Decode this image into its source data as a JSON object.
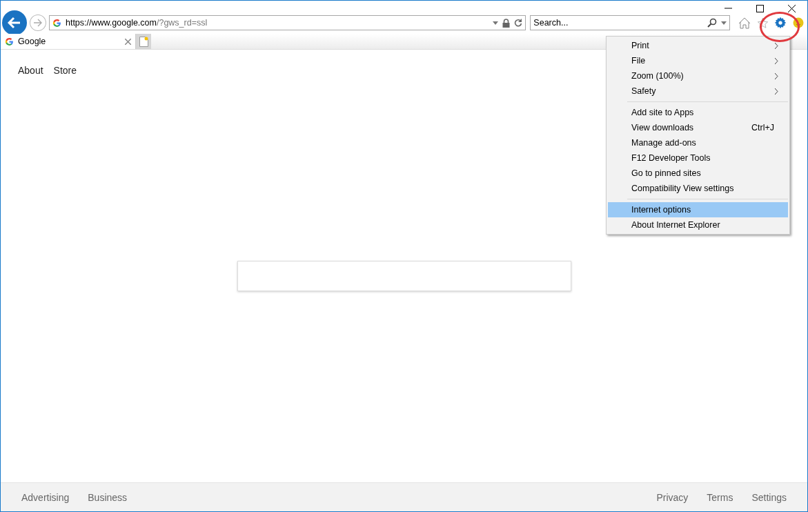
{
  "address_bar": {
    "url_main": "https://www.google.com",
    "url_rest": "/?gws_rd=ssl"
  },
  "search_box": {
    "placeholder": "Search..."
  },
  "tabs": [
    {
      "label": "Google",
      "selected": true
    }
  ],
  "page": {
    "top_links": [
      "About",
      "Store"
    ],
    "footer_left": [
      "Advertising",
      "Business"
    ],
    "footer_right": [
      "Privacy",
      "Terms",
      "Settings"
    ]
  },
  "tools_menu": {
    "groups": [
      [
        {
          "label": "Print",
          "kind": "submenu",
          "selected": false
        },
        {
          "label": "File",
          "kind": "submenu",
          "selected": false
        },
        {
          "label": "Zoom (100%)",
          "kind": "submenu",
          "selected": false
        },
        {
          "label": "Safety",
          "kind": "submenu",
          "selected": false
        }
      ],
      [
        {
          "label": "Add site to Apps",
          "kind": "plain",
          "selected": false
        },
        {
          "label": "View downloads",
          "kind": "shortcut",
          "shortcut": "Ctrl+J",
          "selected": false
        },
        {
          "label": "Manage add-ons",
          "kind": "plain",
          "selected": false
        },
        {
          "label": "F12 Developer Tools",
          "kind": "plain",
          "selected": false
        },
        {
          "label": "Go to pinned sites",
          "kind": "plain",
          "selected": false
        },
        {
          "label": "Compatibility View settings",
          "kind": "plain",
          "selected": false
        }
      ],
      [
        {
          "label": "Internet options",
          "kind": "plain",
          "selected": true
        },
        {
          "label": "About Internet Explorer",
          "kind": "plain",
          "selected": false
        }
      ]
    ]
  }
}
